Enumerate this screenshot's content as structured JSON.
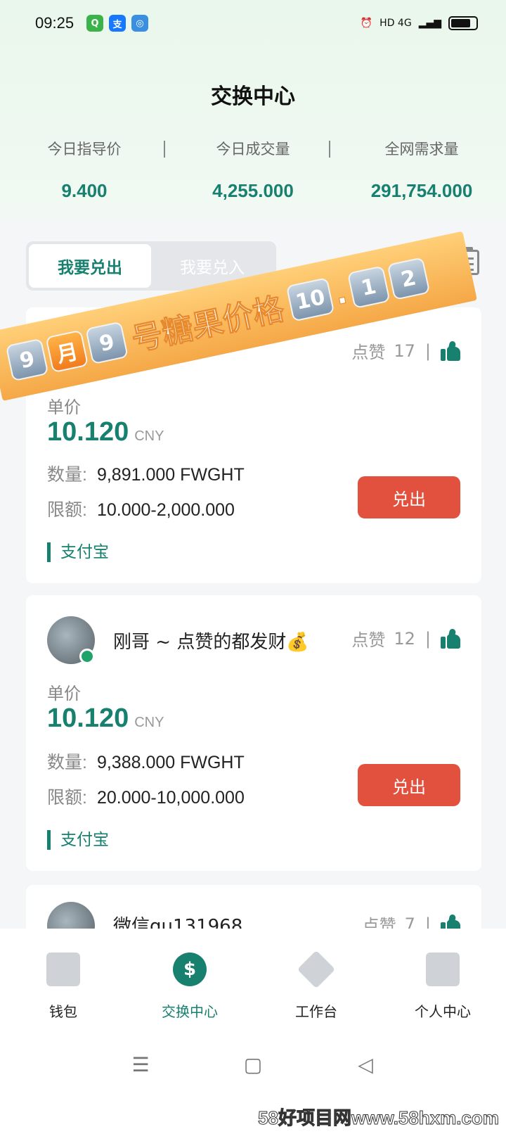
{
  "status_bar": {
    "time": "09:25",
    "network": "HD 4G"
  },
  "header": {
    "title": "交换中心"
  },
  "stats": [
    {
      "label": "今日指导价",
      "value": "9.400"
    },
    {
      "label": "今日成交量",
      "value": "4,255.000"
    },
    {
      "label": "全网需求量",
      "value": "291,754.000"
    }
  ],
  "tabs": {
    "sell": "我要兑出",
    "buy": "我要兑入"
  },
  "banner": {
    "chars": [
      "9",
      "月",
      "9"
    ],
    "text": "号糖果价格",
    "price_chars": [
      "10",
      ".",
      "1",
      "2"
    ]
  },
  "cards": [
    {
      "user": "",
      "likes_label": "点赞",
      "likes": "17",
      "price_label": "单价",
      "price": "10.120",
      "currency": "CNY",
      "qty_label": "数量:",
      "qty": "9,891.000 FWGHT",
      "limit_label": "限额:",
      "limit": "10.000-2,000.000",
      "button": "兑出",
      "payment": "支付宝"
    },
    {
      "user": "刚哥 ~ 点赞的都发财💰",
      "likes_label": "点赞",
      "likes": "12",
      "price_label": "单价",
      "price": "10.120",
      "currency": "CNY",
      "qty_label": "数量:",
      "qty": "9,388.000 FWGHT",
      "limit_label": "限额:",
      "limit": "20.000-10,000.000",
      "button": "兑出",
      "payment": "支付宝"
    },
    {
      "user": "微信qu131968",
      "likes_label": "点赞",
      "likes": "7"
    }
  ],
  "bottom_nav": [
    {
      "label": "钱包",
      "icon": "wallet-icon"
    },
    {
      "label": "交换中心",
      "icon": "exchange-icon"
    },
    {
      "label": "工作台",
      "icon": "layers-icon"
    },
    {
      "label": "个人中心",
      "icon": "profile-icon"
    }
  ],
  "watermark": "58好项目网www.58hxm.com",
  "colors": {
    "accent": "#17806f",
    "button": "#e2513e",
    "banner": "#f5a847"
  }
}
